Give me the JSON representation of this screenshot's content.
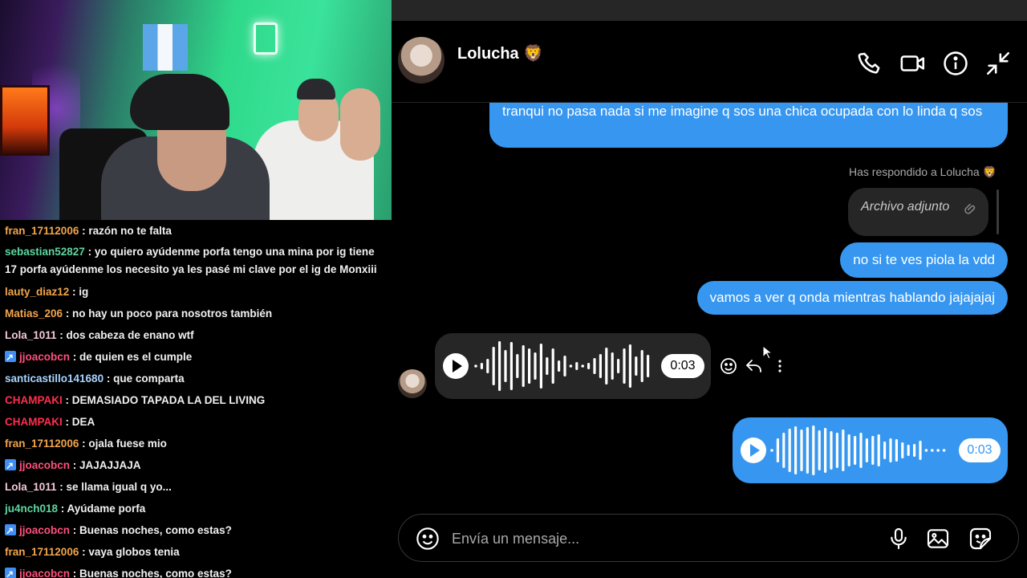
{
  "chat": {
    "messages": [
      {
        "user": "fran_17112006",
        "color": "#f2a54a",
        "text": ": razón no te falta",
        "badge": false
      },
      {
        "user": "sebastian52827",
        "color": "#5fd6a0",
        "text": ": yo quiero ayúdenme porfa tengo una mina por ig tiene 17 porfa ayúdenme los necesito ya les pasé mi clave por el ig de Monxiii",
        "badge": false
      },
      {
        "user": "lauty_diaz12",
        "color": "#f2a54a",
        "text": ": ig",
        "badge": false
      },
      {
        "user": "Matias_206",
        "color": "#f2a54a",
        "text": ": no hay un poco para nosotros también",
        "badge": false
      },
      {
        "user": "Lola_1011",
        "color": "#f3c9d8",
        "text": ": dos cabeza de enano wtf",
        "badge": false
      },
      {
        "user": "jjoacobcn",
        "color": "#ff4f7b",
        "text": ": de quien es el cumple",
        "badge": true
      },
      {
        "user": "santicastillo141680",
        "color": "#a9d4ff",
        "text": ": que comparta",
        "badge": false
      },
      {
        "user": "CHAMPAKI",
        "color": "#ff2e4d",
        "text": ": DEMASIADO TAPADA LA DEL LIVING",
        "badge": false
      },
      {
        "user": "CHAMPAKI",
        "color": "#ff2e4d",
        "text": ": DEA",
        "badge": false
      },
      {
        "user": "fran_17112006",
        "color": "#f2a54a",
        "text": ": ojala fuese mio",
        "badge": false
      },
      {
        "user": "jjoacobcn",
        "color": "#ff4f7b",
        "text": ": JAJAJJAJA",
        "badge": true
      },
      {
        "user": "Lola_1011",
        "color": "#f3c9d8",
        "text": ": se llama igual q yo...",
        "badge": false
      },
      {
        "user": "ju4nch018",
        "color": "#5fd6a0",
        "text": ": Ayúdame porfa",
        "badge": false
      },
      {
        "user": "jjoacobcn",
        "color": "#ff4f7b",
        "text": ": Buenas noches, como estas?",
        "badge": true
      },
      {
        "user": "fran_17112006",
        "color": "#f2a54a",
        "text": ": vaya globos tenia",
        "badge": false
      },
      {
        "user": "jjoacobcn",
        "color": "#ff4f7b",
        "text": ": Buenas noches, como estas?",
        "badge": true
      }
    ]
  },
  "dm": {
    "contact_name": "Lolucha 🦁",
    "header_icons": [
      "phone-icon",
      "video-call-icon",
      "info-icon",
      "minimize-icon"
    ],
    "msg1": "tranqui no pasa nada si me imagine q sos una chica ocupada con lo linda q sos",
    "replied_note": "Has respondido a Lolucha 🦁",
    "attachment_label": "Archivo adjunto",
    "msg2": "no si te ves piola la vdd",
    "msg3": "vamos a ver q onda mientras  hablando jajajajaj",
    "voice_in_duration": "0:03",
    "voice_out_duration": "0:03",
    "composer_placeholder": "Envía un mensaje...",
    "accent": "#3797f0"
  }
}
